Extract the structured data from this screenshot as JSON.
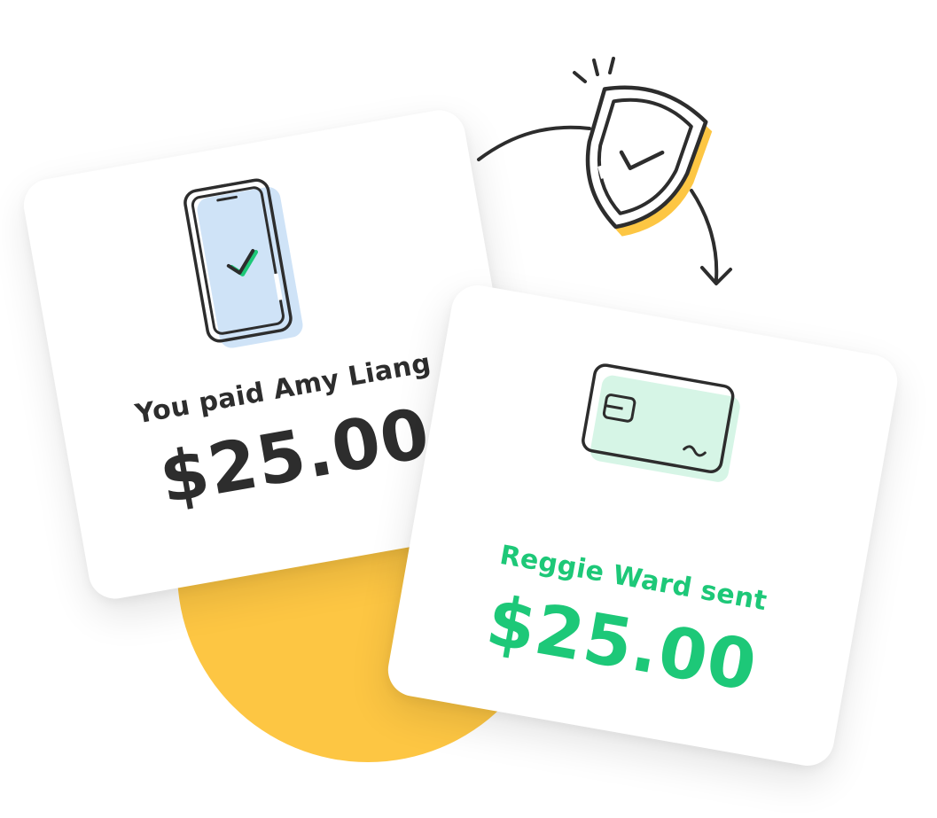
{
  "colors": {
    "yellow": "#FDC643",
    "green": "#1DC878",
    "dark": "#2d2d2d",
    "phone_accent": "#CFE3F7",
    "card_accent": "#D6F5E6"
  },
  "left_card": {
    "icon": "phone-check-icon",
    "label": "You paid Amy Liang",
    "amount": "$25.00"
  },
  "right_card": {
    "icon": "credit-card-icon",
    "label": "Reggie Ward sent",
    "amount": "$25.00"
  },
  "shield": {
    "icon": "shield-check-icon"
  }
}
